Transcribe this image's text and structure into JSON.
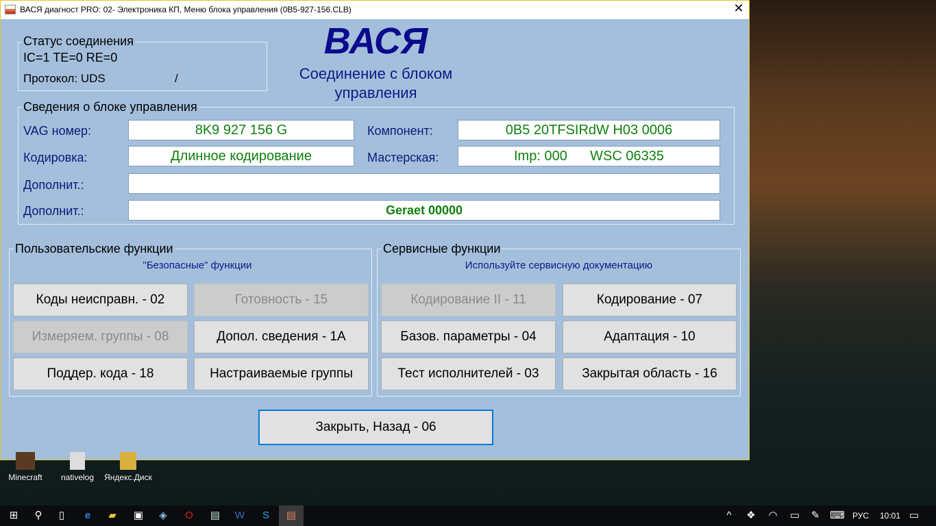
{
  "window": {
    "title": "ВАСЯ диагност PRO: 02- Электроника КП,  Меню блока управления (0B5-927-156.CLB)",
    "close": "✕"
  },
  "status": {
    "legend": "Статус соединения",
    "line1": "IC=1  TE=0   RE=0",
    "protocol": "Протокол: UDS",
    "slash": "/"
  },
  "logo": {
    "text": "ВАСЯ",
    "subtitle1": "Соединение с блоком",
    "subtitle2": "управления"
  },
  "info": {
    "legend": "Сведения о блоке управления",
    "vag_label": "VAG номер:",
    "vag_value": "8K9 927 156 G",
    "component_label": "Компонент:",
    "component_value": "0B5 20TFSIRdW H03 0006",
    "coding_label": "Кодировка:",
    "coding_value": "Длинное кодирование",
    "shop_label": "Мастерская:",
    "shop_value": "Imp: 000      WSC 06335",
    "extra1_label": "Дополнит.:",
    "extra1_value": "",
    "extra2_label": "Дополнит.:",
    "extra2_value": "Geraet 00000"
  },
  "user": {
    "legend": "Пользовательские функции",
    "subtitle": "\"Безопасные\" функции",
    "buttons": [
      "Коды неисправн. - 02",
      "Готовность - 15",
      "Измеряем. группы - 08",
      "Допол. сведения - 1A",
      "Поддер. кода - 18",
      "Настраиваемые группы"
    ]
  },
  "service": {
    "legend": "Сервисные функции",
    "subtitle": "Используйте сервисную документацию",
    "buttons": [
      "Кодирование II - 11",
      "Кодирование - 07",
      "Базов. параметры - 04",
      "Адаптация - 10",
      "Тест исполнителей - 03",
      "Закрытая область - 16"
    ]
  },
  "close_button": "Закрыть, Назад - 06",
  "desktop": {
    "icons": [
      "Minecraft",
      "nativelog",
      "Яндекс.Диск"
    ]
  },
  "taskbar": {
    "lang": "РУС",
    "time": "10:01"
  }
}
